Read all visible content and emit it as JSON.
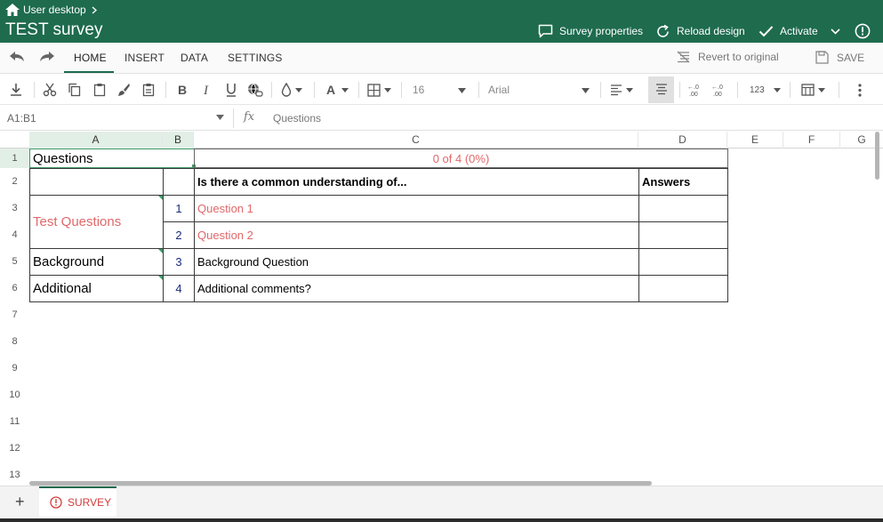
{
  "titlebar": {
    "breadcrumb": "User desktop",
    "title": "TEST survey",
    "actions": {
      "survey_properties": "Survey properties",
      "reload_design": "Reload design",
      "activate": "Activate"
    }
  },
  "ribbon": {
    "tabs": [
      "HOME",
      "INSERT",
      "DATA",
      "SETTINGS"
    ],
    "active_tab": "HOME",
    "revert": "Revert to original",
    "save": "SAVE"
  },
  "toolbar": {
    "font_size": "16",
    "font_name": "Arial",
    "number_format": "123"
  },
  "formula_bar": {
    "name_box": "A1:B1",
    "fx": "fx",
    "value": "Questions"
  },
  "grid": {
    "columns": [
      "A",
      "B",
      "C",
      "D",
      "E",
      "F",
      "G"
    ],
    "rows": [
      "1",
      "2",
      "3",
      "4",
      "5",
      "6",
      "7",
      "8",
      "9",
      "10",
      "11",
      "12",
      "13"
    ],
    "cells": {
      "a1": "Questions",
      "c1": "0 of 4 (0%)",
      "c2": "Is there a common understanding of...",
      "d2": "Answers",
      "a3": "Test Questions",
      "b3": "1",
      "c3": "Question 1",
      "b4": "2",
      "c4": "Question 2",
      "a5": "Background",
      "b5": "3",
      "c5": "Background Question",
      "a6": "Additional",
      "b6": "4",
      "c6": "Additional comments?"
    }
  },
  "sheets": {
    "add": "+",
    "active": "SURVEY"
  },
  "colors": {
    "brand": "#1e6b4e",
    "accent_red": "#e0686a",
    "selection": "#e2efe6"
  }
}
